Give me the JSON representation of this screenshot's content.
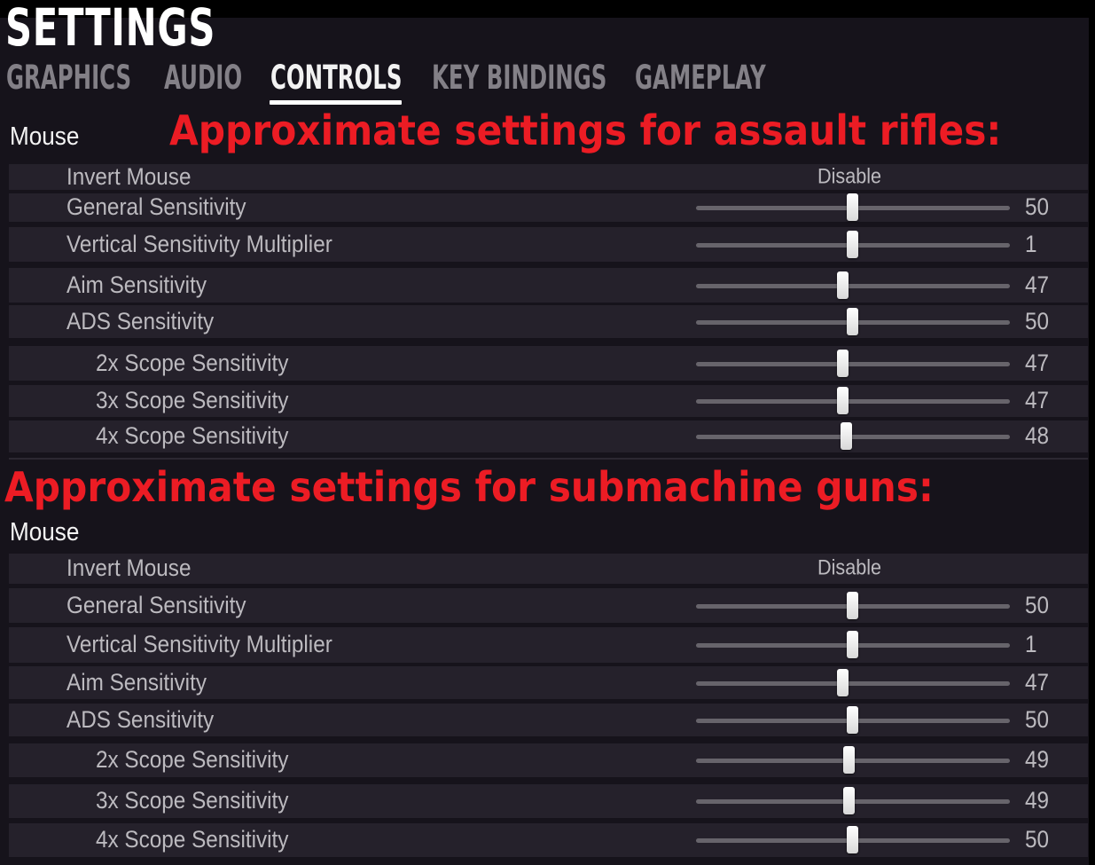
{
  "header": {
    "title": "SETTINGS"
  },
  "tabs": [
    {
      "label": "GRAPHICS",
      "active": false
    },
    {
      "label": "AUDIO",
      "active": false
    },
    {
      "label": "CONTROLS",
      "active": true
    },
    {
      "label": "KEY BINDINGS",
      "active": false
    },
    {
      "label": "GAMEPLAY",
      "active": false
    }
  ],
  "colors": {
    "annotation": "#ec1c24",
    "background": "#16131b",
    "row": "#25212b",
    "active_tab": "#f2f2f2",
    "inactive_tab": "#838087"
  },
  "sections": [
    {
      "annotation": "Approximate settings for assault rifles:",
      "group_label": "Mouse",
      "rows": [
        {
          "label": "Invert Mouse",
          "type": "toggle",
          "value": "Disable"
        },
        {
          "label": "General Sensitivity",
          "type": "slider",
          "value": "50",
          "fraction": 0.5
        },
        {
          "label": "Vertical Sensitivity Multiplier",
          "type": "slider",
          "value": "1",
          "fraction": 0.5
        },
        {
          "label": "Aim Sensitivity",
          "type": "slider",
          "value": "47",
          "fraction": 0.47
        },
        {
          "label": "ADS Sensitivity",
          "type": "slider",
          "value": "50",
          "fraction": 0.5
        },
        {
          "label": "2x Scope Sensitivity",
          "type": "slider",
          "value": "47",
          "fraction": 0.47
        },
        {
          "label": "3x Scope Sensitivity",
          "type": "slider",
          "value": "47",
          "fraction": 0.47
        },
        {
          "label": "4x Scope Sensitivity",
          "type": "slider",
          "value": "48",
          "fraction": 0.48
        }
      ]
    },
    {
      "annotation": "Approximate settings for submachine guns:",
      "group_label": "Mouse",
      "rows": [
        {
          "label": "Invert Mouse",
          "type": "toggle",
          "value": "Disable"
        },
        {
          "label": "General Sensitivity",
          "type": "slider",
          "value": "50",
          "fraction": 0.5
        },
        {
          "label": "Vertical Sensitivity Multiplier",
          "type": "slider",
          "value": "1",
          "fraction": 0.5
        },
        {
          "label": "Aim Sensitivity",
          "type": "slider",
          "value": "47",
          "fraction": 0.47
        },
        {
          "label": "ADS Sensitivity",
          "type": "slider",
          "value": "50",
          "fraction": 0.5
        },
        {
          "label": "2x Scope Sensitivity",
          "type": "slider",
          "value": "49",
          "fraction": 0.49
        },
        {
          "label": "3x Scope Sensitivity",
          "type": "slider",
          "value": "49",
          "fraction": 0.49
        },
        {
          "label": "4x Scope Sensitivity",
          "type": "slider",
          "value": "50",
          "fraction": 0.5
        }
      ]
    }
  ]
}
